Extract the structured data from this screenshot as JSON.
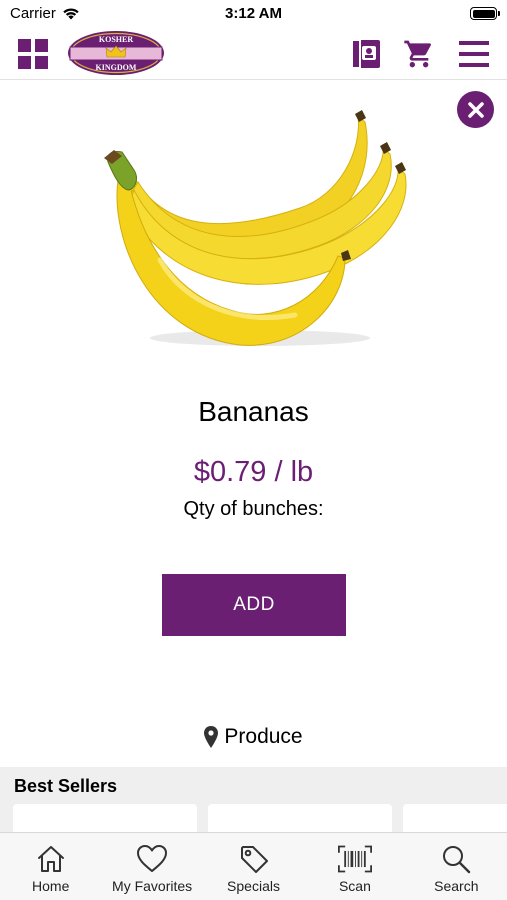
{
  "status_bar": {
    "carrier": "Carrier",
    "time": "3:12 AM"
  },
  "header": {
    "logo_line1": "KOSHER",
    "logo_line2": "KINGDOM",
    "icons": [
      "grid-icon",
      "circular-icon",
      "cart-icon",
      "menu-icon"
    ]
  },
  "product": {
    "name": "Bananas",
    "price": "$0.79 / lb",
    "qty_label": "Qty of bunches:",
    "add_label": "ADD",
    "category": "Produce"
  },
  "best_sellers": {
    "title": "Best Sellers"
  },
  "tabs": [
    {
      "label": "Home",
      "icon": "home-icon"
    },
    {
      "label": "My Favorites",
      "icon": "heart-icon"
    },
    {
      "label": "Specials",
      "icon": "tag-icon"
    },
    {
      "label": "Scan",
      "icon": "barcode-icon"
    },
    {
      "label": "Search",
      "icon": "search-icon"
    }
  ],
  "colors": {
    "brand_purple": "#6b1f73",
    "banana_yellow": "#f4d21a"
  }
}
